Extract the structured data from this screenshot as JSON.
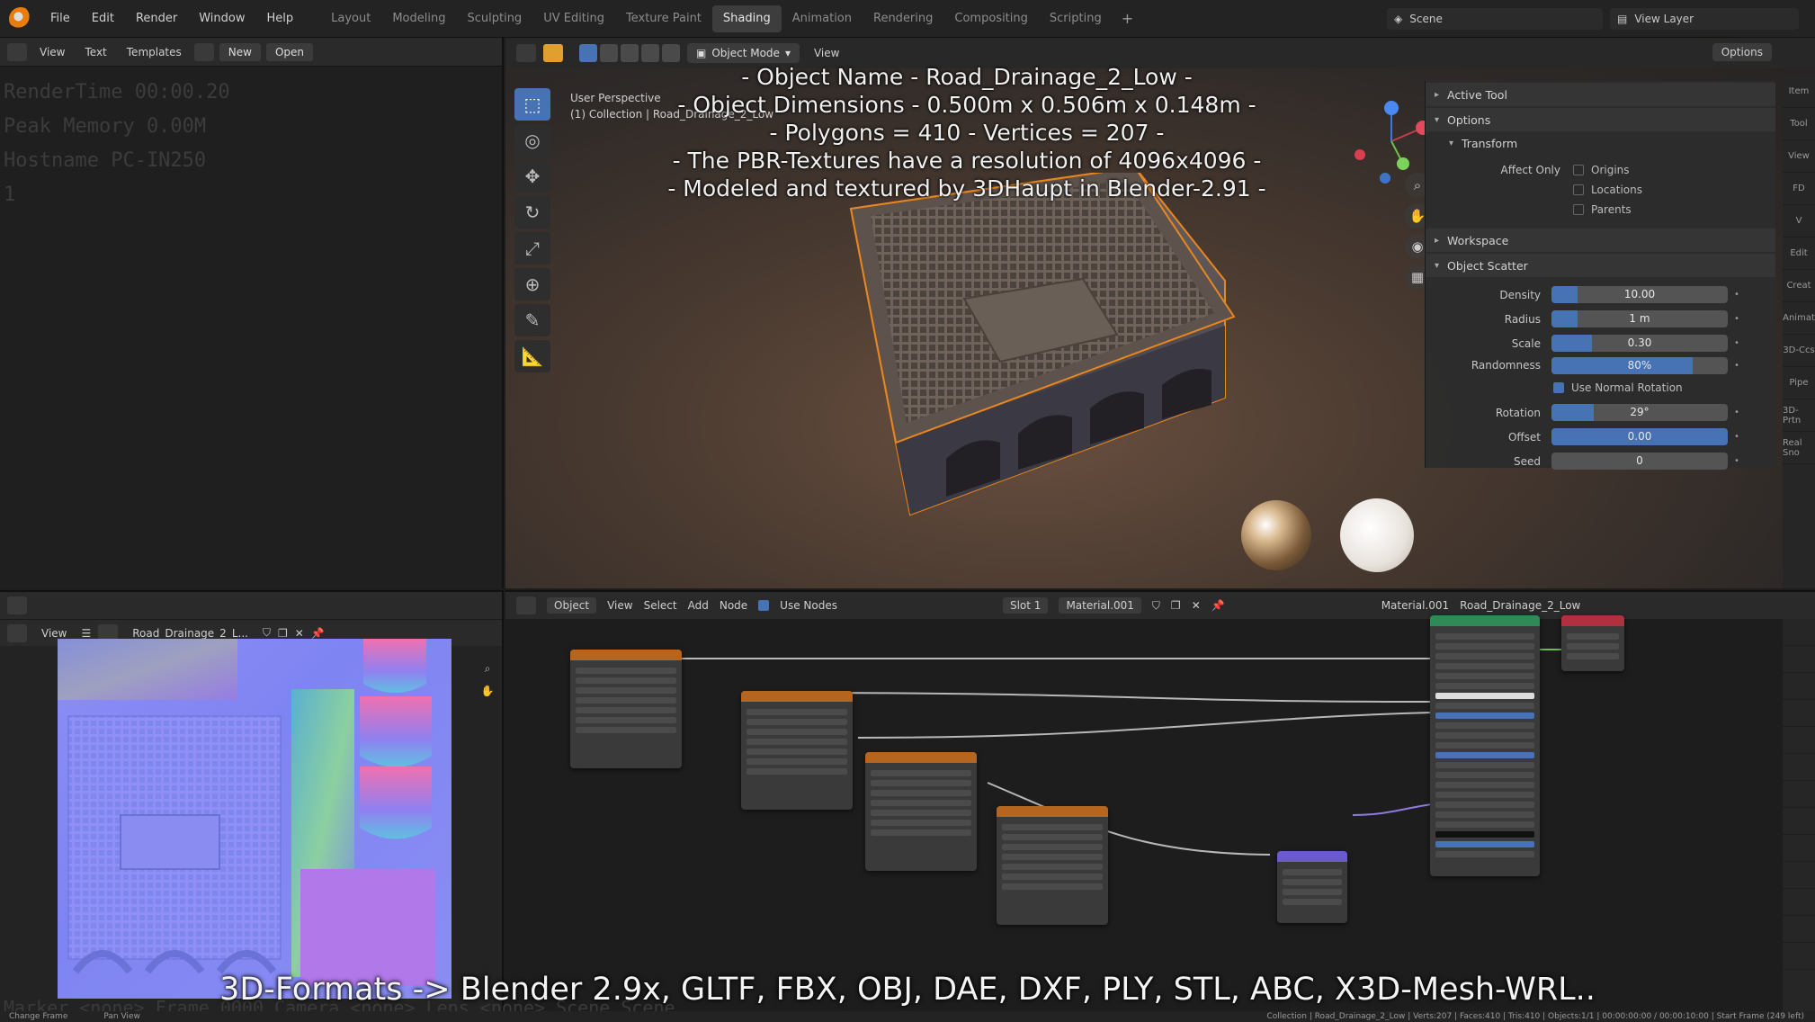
{
  "menu": {
    "items": [
      "File",
      "Edit",
      "Render",
      "Window",
      "Help"
    ],
    "tabs": [
      "Layout",
      "Modeling",
      "Sculpting",
      "UV Editing",
      "Texture Paint",
      "Shading",
      "Animation",
      "Rendering",
      "Compositing",
      "Scripting"
    ],
    "active_tab": "Shading",
    "scene_label": "Scene",
    "view_layer_label": "View Layer"
  },
  "text_editor": {
    "header": {
      "view": "View",
      "text": "Text",
      "templates": "Templates",
      "new": "New",
      "open": "Open"
    },
    "lines": [
      "RenderTime 00:00.20",
      "Peak Memory 0.00M",
      "Hostname PC-IN250",
      "1"
    ]
  },
  "viewport": {
    "mode": "Object Mode",
    "view_menu": "View",
    "options": "Options",
    "info_line1": "User Perspective",
    "info_line2": "(1) Collection | Road_Drainage_2_Low",
    "overlay": [
      "- Object Name - Road_Drainage_2_Low -",
      "- Object Dimensions - 0.500m x 0.506m x 0.148m -",
      "- Polygons = 410 - Vertices = 207 -",
      "- The PBR-Textures have a resolution of 4096x4096 -",
      "- Modeled and textured by 3DHaupt in Blender-2.91 -"
    ]
  },
  "npanel": {
    "active_tool": "Active Tool",
    "options": "Options",
    "transform": "Transform",
    "affect_only": "Affect Only",
    "checks": [
      {
        "label": "Origins",
        "checked": false
      },
      {
        "label": "Locations",
        "checked": false
      },
      {
        "label": "Parents",
        "checked": false
      }
    ],
    "workspace": "Workspace",
    "object_scatter": "Object Scatter",
    "fields": [
      {
        "label": "Density",
        "value": "10.00",
        "fill": 0.15
      },
      {
        "label": "Radius",
        "value": "1 m",
        "fill": 0.15
      },
      {
        "label": "Scale",
        "value": "0.30",
        "fill": 0.23
      },
      {
        "label": "Randomness",
        "value": "80%",
        "fill": 0.8
      }
    ],
    "use_normal_rotation": "Use Normal Rotation",
    "fields2": [
      {
        "label": "Rotation",
        "value": "29°",
        "fill": 0.24
      },
      {
        "label": "Offset",
        "value": "0.00",
        "fill": 1.0
      },
      {
        "label": "Seed",
        "value": "0",
        "fill": 0
      }
    ],
    "side_tabs": [
      "Item",
      "Tool",
      "View",
      "FD",
      "V",
      "Edit",
      "Creat",
      "Animat",
      "3D-Ccs",
      "Pipe",
      "3D-Prtn",
      "Real Sno"
    ]
  },
  "image_editor": {
    "view": "View",
    "image_name": "Road_Drainage_2_L..."
  },
  "node_editor": {
    "object": "Object",
    "view": "View",
    "select": "Select",
    "add": "Add",
    "node": "Node",
    "use_nodes": "Use Nodes",
    "slot": "Slot 1",
    "material": "Material.001",
    "material_right": "Material.001",
    "object_right": "Road_Drainage_2_Low"
  },
  "footer": {
    "formats": "3D-Formats -> Blender 2.9x, GLTF, FBX, OBJ, DAE, DXF, PLY, STL, ABC, X3D-Mesh-WRL..",
    "faint": "Marker <none>    Frame 0000    Camera <none>    Lens <none>    Scene Scene",
    "status_left": "Change Frame",
    "status_mid": "Pan View",
    "status_right": "Collection | Road_Drainage_2_Low | Verts:207 | Faces:410 | Tris:410 | Objects:1/1 | 00:00:00:00 / 00:00:10:00 | Start Frame (249 left)"
  },
  "colors": {
    "accent": "#4772b3",
    "header": "#2a2a2a",
    "selection": "#e8861f"
  }
}
